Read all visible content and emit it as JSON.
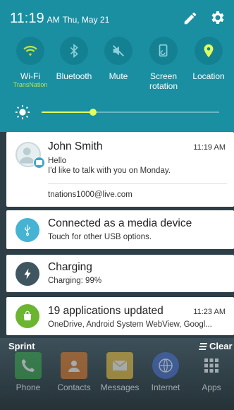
{
  "status_bar": {
    "time": "11:19",
    "ampm": "AM",
    "date": "Thu, May 21"
  },
  "quick_settings": {
    "toggles": [
      {
        "label": "Wi-Fi",
        "sub": "TransNation",
        "icon": "wifi-icon",
        "active_color": "#b9e24a"
      },
      {
        "label": "Bluetooth",
        "sub": "",
        "icon": "bluetooth-icon"
      },
      {
        "label": "Mute",
        "sub": "",
        "icon": "mute-icon"
      },
      {
        "label": "Screen rotation",
        "sub": "",
        "icon": "screen-rotation-icon"
      },
      {
        "label": "Location",
        "sub": "",
        "icon": "location-icon",
        "active_color": "#dfff60"
      }
    ],
    "brightness_level": 0.29
  },
  "notifications": [
    {
      "title": "John Smith",
      "time": "11:19 AM",
      "line1": "Hello",
      "line2": "I'd like to talk with you on Monday.",
      "account": "tnations1000@live.com",
      "icon": "contact-avatar"
    },
    {
      "title": "Connected as a media device",
      "line1": "Touch for other USB options.",
      "icon": "usb-icon",
      "color": "#45b3d3"
    },
    {
      "title": "Charging",
      "line1": "Charging: 99%",
      "icon": "lightning-icon",
      "color": "#3f5660"
    },
    {
      "title": "19 applications updated",
      "time": "11:23 AM",
      "line1": "OneDrive, Android System WebView, Googl...",
      "icon": "store-update-icon",
      "color": "#6bb530"
    }
  ],
  "footer": {
    "carrier": "Sprint",
    "clear_label": "Clear"
  },
  "dock": [
    {
      "label": "Phone",
      "icon": "phone-icon",
      "color": "#3aa54a"
    },
    {
      "label": "Contacts",
      "icon": "contacts-icon",
      "color": "#e27a2a"
    },
    {
      "label": "Messages",
      "icon": "messages-icon",
      "color": "#f0c040"
    },
    {
      "label": "Internet",
      "icon": "internet-icon",
      "color": "#4a6fd1"
    },
    {
      "label": "Apps",
      "icon": "apps-grid-icon",
      "color": "#ffffff"
    }
  ]
}
